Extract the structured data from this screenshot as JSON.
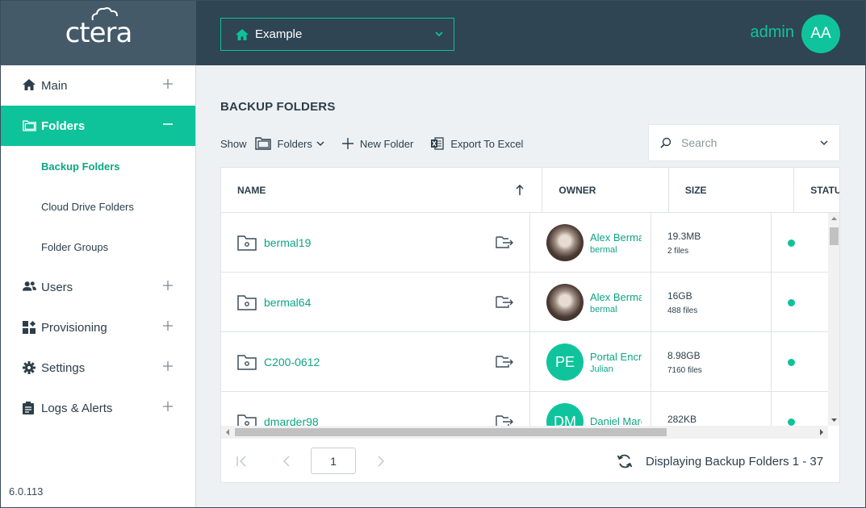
{
  "brand": {
    "logo_text": "ctera"
  },
  "header": {
    "portal_selector": "Example",
    "user_name": "admin",
    "user_initials": "AA"
  },
  "sidebar": {
    "items": [
      {
        "label": "Main",
        "icon": "home-icon"
      },
      {
        "label": "Folders",
        "icon": "folders-icon"
      },
      {
        "label": "Users",
        "icon": "users-icon"
      },
      {
        "label": "Provisioning",
        "icon": "provisioning-icon"
      },
      {
        "label": "Settings",
        "icon": "gear-icon"
      },
      {
        "label": "Logs & Alerts",
        "icon": "clipboard-icon"
      }
    ],
    "sub_items": [
      "Backup Folders",
      "Cloud Drive Folders",
      "Folder Groups"
    ],
    "version": "6.0.113"
  },
  "main": {
    "title": "BACKUP FOLDERS",
    "show_label": "Show",
    "show_value": "Folders",
    "new_folder_label": "New Folder",
    "export_label": "Export To Excel",
    "search_placeholder": "Search"
  },
  "table": {
    "columns": [
      "NAME",
      "OWNER",
      "SIZE",
      "STATUS"
    ],
    "rows": [
      {
        "name": "bermal19",
        "owner_name": "Alex Bermal",
        "owner_user": "bermal",
        "owner_initials": "",
        "size": "19.3MB",
        "files": "2 files"
      },
      {
        "name": "bermal64",
        "owner_name": "Alex Bermal",
        "owner_user": "bermal",
        "owner_initials": "",
        "size": "16GB",
        "files": "488 files"
      },
      {
        "name": "C200-0612",
        "owner_name": "Portal Encryption",
        "owner_user": "Julian",
        "owner_initials": "PE",
        "size": "8.98GB",
        "files": "7160 files"
      },
      {
        "name": "dmarder98",
        "owner_name": "Daniel Marder",
        "owner_user": "",
        "owner_initials": "DM",
        "size": "282KB",
        "files": ""
      }
    ],
    "status_color": "#0ec29a"
  },
  "pager": {
    "page": "1",
    "display_text": "Displaying Backup Folders 1 - 37"
  },
  "colors": {
    "accent": "#0ec29a",
    "topbar": "#2f4553",
    "logo_bg": "#445a69"
  }
}
